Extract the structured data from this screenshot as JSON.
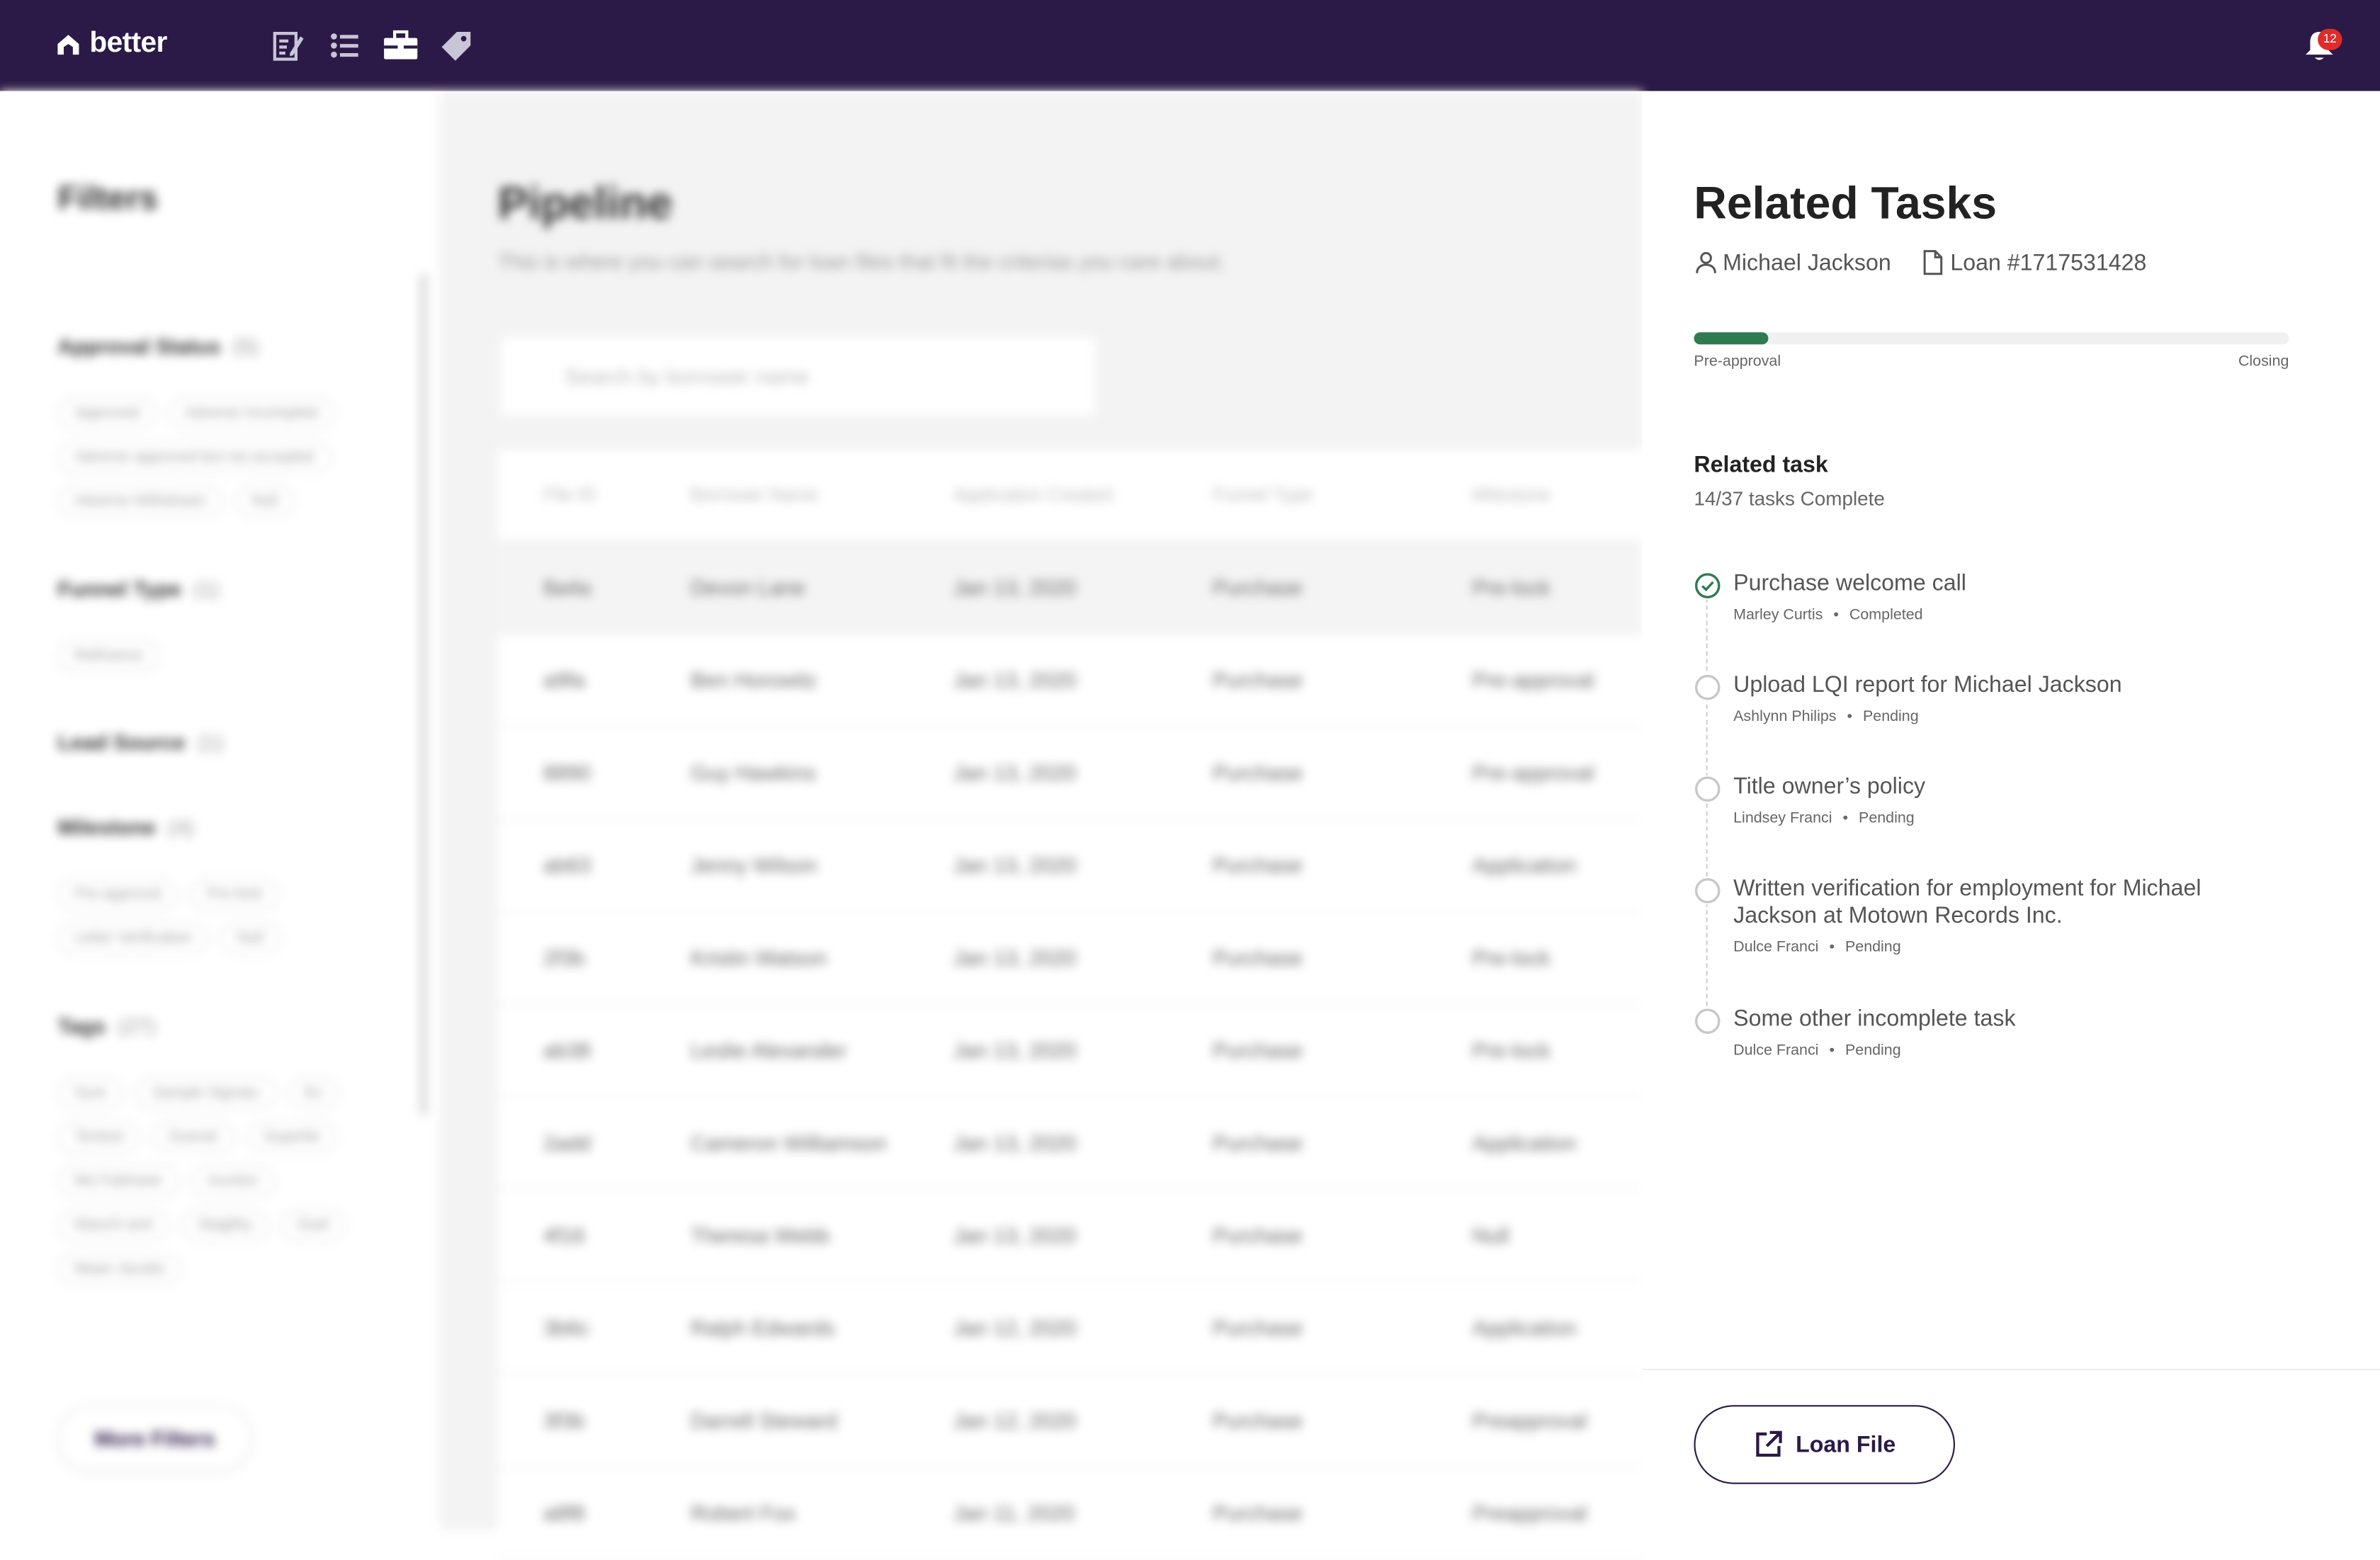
{
  "app": {
    "brand": "better",
    "notification_count": "12"
  },
  "nav": {
    "icons": [
      "edit-document-icon",
      "list-icon",
      "briefcase-icon",
      "tag-icon"
    ]
  },
  "filters": {
    "title": "Filters",
    "groups": [
      {
        "label": "Approval Status",
        "count": "(5)",
        "chips": [
          "Approved",
          "Adverse Incomplete",
          "Adverse approved but not accepted",
          "Adverse Withdrawn",
          "Null"
        ]
      },
      {
        "label": "Funnel Type",
        "count": "(1)",
        "chips": [
          "Refinance"
        ]
      },
      {
        "label": "Lead Source",
        "count": "(1)",
        "chips": []
      },
      {
        "label": "Milestone",
        "count": "(4)",
        "chips": [
          "Pre-approval",
          "Pre-lock",
          "Letter Verification",
          "Null"
        ]
      },
      {
        "label": "Tags",
        "count": "(27)",
        "chips": [
          "Sure",
          "Sample Signatu",
          "Ex",
          "Tentest",
          "Duenet",
          "Superlet",
          "Ma Fatitrawe",
          "Auction",
          "Maschi and",
          "Stagithy",
          "Duel",
          "Maan Jacobs"
        ]
      }
    ],
    "more_button": "More Filters"
  },
  "pipeline": {
    "title": "Pipeline",
    "subtitle": "This is where you can search for loan files that fit the criterias you care about.",
    "search_placeholder": "Search by borrower name",
    "columns": [
      "File ID",
      "Borrower Name",
      "Application Created",
      "Funnel Type",
      "Milestone"
    ],
    "rows": [
      [
        "8a4a",
        "Devon Lane",
        "Jan 13, 2020",
        "Purchase",
        "Pre-lock"
      ],
      [
        "a9fa",
        "Ben Horowitz",
        "Jan 13, 2020",
        "Purchase",
        "Pre-approval"
      ],
      [
        "8890",
        "Guy Hawkins",
        "Jan 13, 2020",
        "Purchase",
        "Pre-approval"
      ],
      [
        "ab63",
        "Jenny Wilson",
        "Jan 13, 2020",
        "Purchase",
        "Application"
      ],
      [
        "2f3b",
        "Kristin Watson",
        "Jan 13, 2020",
        "Purchase",
        "Pre-lock"
      ],
      [
        "ab38",
        "Leslie Alexander",
        "Jan 13, 2020",
        "Purchase",
        "Pre-lock"
      ],
      [
        "2add",
        "Cameron Williamson",
        "Jan 13, 2020",
        "Purchase",
        "Application"
      ],
      [
        "4f16",
        "Theresa Webb",
        "Jan 13, 2020",
        "Purchase",
        "Null"
      ],
      [
        "3b6c",
        "Ralph Edwards",
        "Jan 12, 2020",
        "Purchase",
        "Application"
      ],
      [
        "3f3b",
        "Darrell Steward",
        "Jan 12, 2020",
        "Purchase",
        "Preapproval"
      ],
      [
        "a8f8",
        "Robert Fox",
        "Jan 11, 2020",
        "Purchase",
        "Preapproval"
      ]
    ]
  },
  "related": {
    "title": "Related Tasks",
    "borrower": "Michael Jackson",
    "loan": "Loan #1717531428",
    "progress_fraction": 0.125,
    "progress_start": "Pre-approval",
    "progress_end": "Closing",
    "section_title": "Related task",
    "section_summary": "14/37 tasks Complete",
    "tasks": [
      {
        "title": "Purchase welcome call",
        "assignee": "Marley Curtis",
        "status": "Completed",
        "done": true
      },
      {
        "title": "Upload LQI report for Michael Jackson",
        "assignee": "Ashlynn Philips",
        "status": "Pending",
        "done": false
      },
      {
        "title": "Title owner’s policy",
        "assignee": "Lindsey Franci",
        "status": "Pending",
        "done": false
      },
      {
        "title": "Written verification for employment for Michael Jackson at Motown Records Inc.",
        "assignee": "Dulce Franci",
        "status": "Pending",
        "done": false
      },
      {
        "title": "Some other incomplete task",
        "assignee": "Dulce Franci",
        "status": "Pending",
        "done": false
      }
    ],
    "button_label": "Loan File",
    "accent_color": "#2e7b4f",
    "brand_color": "#2b1a47"
  }
}
